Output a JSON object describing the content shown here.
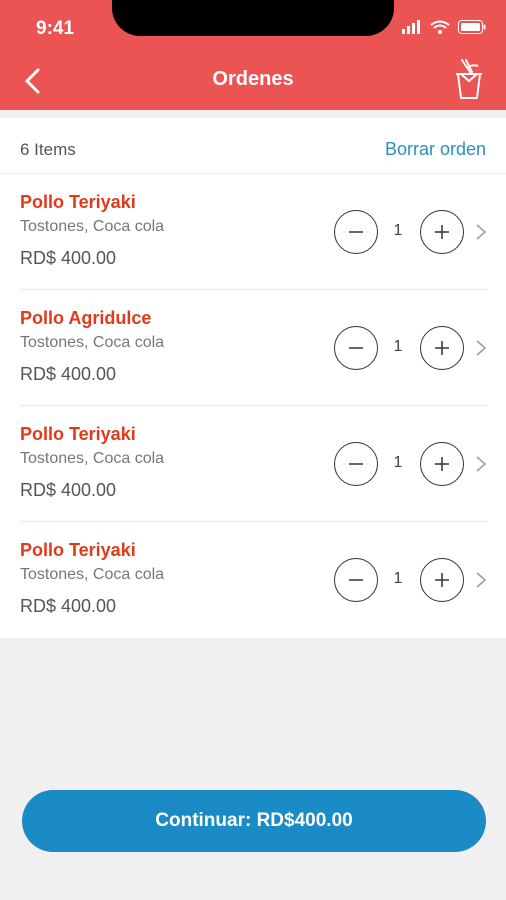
{
  "status_bar": {
    "time": "9:41"
  },
  "header": {
    "title": "Ordenes",
    "back_icon": "chevron-left-icon",
    "cart_icon": "takeout-box-icon"
  },
  "summary": {
    "items_count": "6 Items",
    "clear_label": "Borrar orden"
  },
  "order_items": [
    {
      "name": "Pollo Teriyaki",
      "description": "Tostones, Coca cola",
      "price": "RD$ 400.00",
      "quantity": "1"
    },
    {
      "name": "Pollo Agridulce",
      "description": "Tostones, Coca cola",
      "price": "RD$ 400.00",
      "quantity": "1"
    },
    {
      "name": "Pollo Teriyaki",
      "description": "Tostones, Coca cola",
      "price": "RD$ 400.00",
      "quantity": "1"
    },
    {
      "name": "Pollo Teriyaki",
      "description": "Tostones, Coca cola",
      "price": "RD$ 400.00",
      "quantity": "1"
    }
  ],
  "footer": {
    "continue_label": "Continuar: RD$400.00"
  },
  "colors": {
    "header": "#ec5353",
    "item_name": "#e03a1a",
    "link": "#2c8fc0",
    "primary_button": "#1a8bc4"
  }
}
